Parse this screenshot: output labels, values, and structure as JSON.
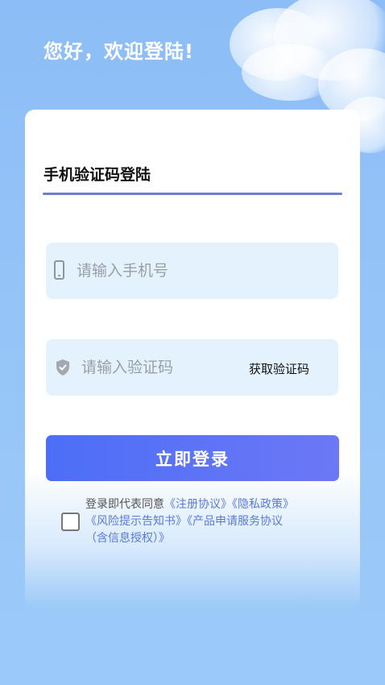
{
  "header": {
    "greeting": "您好，欢迎登陆!"
  },
  "login_form": {
    "tab_title": "手机验证码登陆",
    "phone": {
      "placeholder": "请输入手机号",
      "value": "",
      "icon": "phone-icon"
    },
    "code": {
      "placeholder": "请输入验证码",
      "value": "",
      "icon": "shield-icon",
      "get_code_label": "获取验证码"
    },
    "submit_label": "立即登录"
  },
  "agreement": {
    "checked": false,
    "prefix": "登录即代表同意",
    "links": [
      "《注册协议》",
      "《隐私政策》",
      "《风险提示告知书》",
      "《产品申请服务协议",
      "（含信息授权）》"
    ]
  },
  "colors": {
    "background": "#8fc0f7",
    "accent": "#4c6ef7",
    "link": "#5b7ad6",
    "field_bg": "#e3f2fd"
  }
}
